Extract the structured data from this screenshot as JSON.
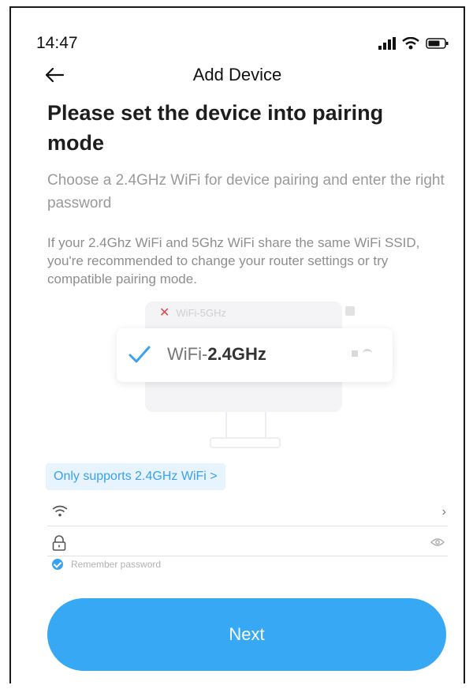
{
  "status_bar": {
    "time": "14:47",
    "icons": [
      "signal-icon",
      "wifi-icon",
      "battery-icon"
    ]
  },
  "nav": {
    "back_icon": "back-arrow-icon",
    "title": "Add Device"
  },
  "content": {
    "headline": "Please set the device into pairing mode",
    "subhead": "Choose a 2.4GHz WiFi for device pairing and enter the right password",
    "note": "If your 2.4Ghz WiFi and 5Ghz WiFi share the same WiFi SSID, you're recommended to change your router settings or try compatible pairing mode."
  },
  "illustration": {
    "wifi5_label": "WiFi-5GHz",
    "wifi24_prefix": "WiFi-",
    "wifi24_band": "2.4GHz"
  },
  "supports_chip": "Only supports 2.4GHz WiFi >",
  "form": {
    "wifi_value": "",
    "password_value": "",
    "remember_label": "Remember password",
    "remember_checked": true
  },
  "next_button": "Next",
  "colors": {
    "accent": "#36a8f4",
    "chip_bg": "#e8f4fd",
    "error_x": "#e0484a"
  }
}
